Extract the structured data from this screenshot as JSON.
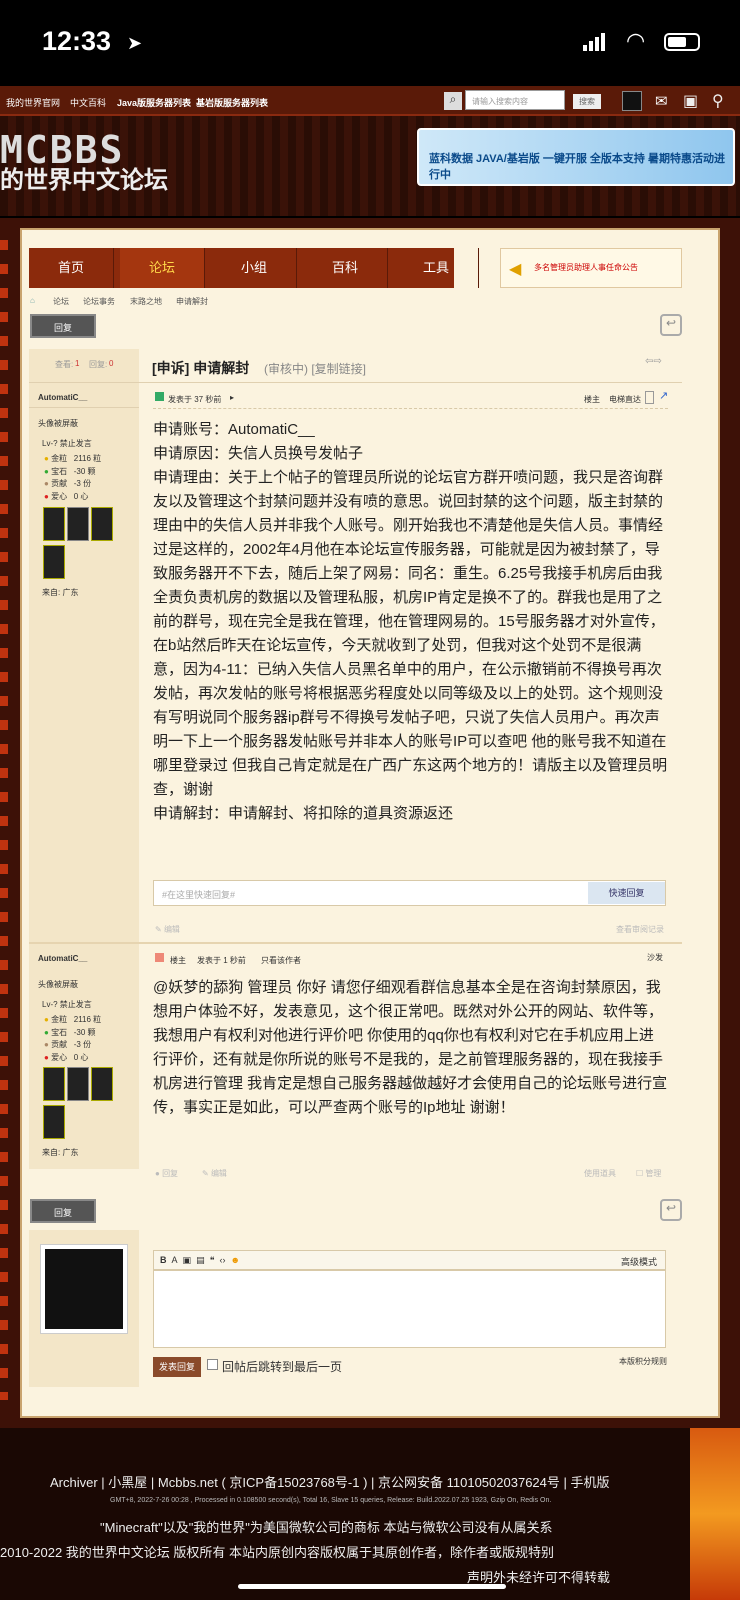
{
  "status": {
    "time": "12:33"
  },
  "topnav": {
    "items": [
      "我的世界官网",
      "中文百科",
      "Java版服务器列表",
      "基岩版服务器列表"
    ],
    "search_placeholder": "请输入搜索内容",
    "search_button": "搜索"
  },
  "header": {
    "logo_top": "MCBBS",
    "logo_sub": "的世界中文论坛",
    "ad_text": "蓝科数据 JAVA/基岩版 一键开服 全版本支持 暑期特惠活动进行中"
  },
  "mainnav": {
    "items": [
      "首页",
      "论坛",
      "小组",
      "百科",
      "工具"
    ],
    "notice": "多名管理员助理人事任命公告"
  },
  "breadcrumb": [
    "论坛",
    "论坛事务",
    "末路之地",
    "申请解封"
  ],
  "reply_button": "回复",
  "thread": {
    "views_label": "查看:",
    "views": "1",
    "replies_label": "回复:",
    "replies": "0",
    "title": "[申诉] 申请解封",
    "title_meta": "(审核中) [复制链接]"
  },
  "post1": {
    "author": "AutomatiC__",
    "author_status": "头像被屏蔽",
    "level": "Lv-? 禁止发言",
    "stats": [
      {
        "label": "金粒",
        "value": "2116 粒"
      },
      {
        "label": "宝石",
        "value": "-30 颗"
      },
      {
        "label": "贡献",
        "value": "-3 份"
      },
      {
        "label": "爱心",
        "value": "0 心"
      }
    ],
    "from": "来自: 广东",
    "posted": "发表于 37 秒前",
    "floor": "楼主",
    "elevator": "电梯直达",
    "lines": [
      "申请账号：AutomatiC__",
      "申请原因：失信人员换号发帖子",
      "申请理由：关于上个帖子的管理员所说的论坛官方群开喷问题，我只是咨询群友以及管理这个封禁问题并没有喷的意思。说回封禁的这个问题，版主封禁的理由中的失信人员并非我个人账号。刚开始我也不清楚他是失信人员。事情经过是这样的，2002年4月他在本论坛宣传服务器，可能就是因为被封禁了，导致服务器开不下去，随后上架了网易：同名：重生。6.25号我接手机房后由我全责负责机房的数据以及管理私服，机房IP肯定是换不了的。群我也是用了之前的群号，现在完全是我在管理，他在管理网易的。15号服务器才对外宣传，在b站然后昨天在论坛宣传，今天就收到了处罚，但我对这个处罚不是很满意，因为4-11：已纳入失信人员黑名单中的用户，在公示撤销前不得换号再次发帖，再次发帖的账号将根据恶劣程度处以同等级及以上的处罚。这个规则没有写明说同个服务器ip群号不得换号发帖子吧，只说了失信人员用户。再次声明一下上一个服务器发帖账号并非本人的账号IP可以查吧 他的账号我不知道在哪里登录过 但我自己肯定就是在广西广东这两个地方的！请版主以及管理员明查，谢谢",
      "申请解封：申请解封、将扣除的道具资源返还"
    ],
    "quick_reply_placeholder": "#在这里快速回复#",
    "quick_reply_button": "快速回复",
    "edit": "编辑",
    "review": "查看审阅记录"
  },
  "post2": {
    "author": "AutomatiC__",
    "author_status": "头像被屏蔽",
    "level": "Lv-? 禁止发言",
    "stats": [
      {
        "label": "金粒",
        "value": "2116 粒"
      },
      {
        "label": "宝石",
        "value": "-30 颗"
      },
      {
        "label": "贡献",
        "value": "-3 份"
      },
      {
        "label": "爱心",
        "value": "0 心"
      }
    ],
    "from": "来自: 广东",
    "floor": "楼主",
    "posted": "发表于 1 秒前",
    "only_author": "只看该作者",
    "position": "沙发",
    "body": "@妖梦的舔狗 管理员 你好 请您仔细观看群信息基本全是在咨询封禁原因，我想用户体验不好，发表意见，这个很正常吧。既然对外公开的网站、软件等，我想用户有权利对他进行评价吧 你使用的qq你也有权利对它在手机应用上进行评价，还有就是你所说的账号不是我的，是之前管理服务器的，现在我接手机房进行管理 我肯定是想自己服务器越做越好才会使用自己的论坛账号进行宣传，事实正是如此，可以严查两个账号的Ip地址 谢谢！",
    "reply": "回复",
    "edit": "编辑",
    "tools": "使用道具",
    "manage": "管理"
  },
  "editor": {
    "advanced": "高级模式",
    "submit": "发表回复",
    "jump_label": "回帖后跳转到最后一页",
    "rules": "本版积分规则"
  },
  "footer": {
    "line1": "Archiver | 小黑屋 | Mcbbs.net ( 京ICP备15023768号-1 ) | 京公网安备 11010502037624号 | 手机版",
    "line2": "GMT+8, 2022-7-26 00:28 , Processed in 0.108500 second(s), Total 16, Slave 15 queries, Release: Build.2022.07.25 1923, Gzip On, Redis On.",
    "line3": "\"Minecraft\"以及\"我的世界\"为美国微软公司的商标 本站与微软公司没有从属关系",
    "line4": "2010-2022 我的世界中文论坛 版权所有 本站内原创内容版权属于其原创作者，除作者或版规特别",
    "line5": "声明外未经许可不得转载"
  }
}
